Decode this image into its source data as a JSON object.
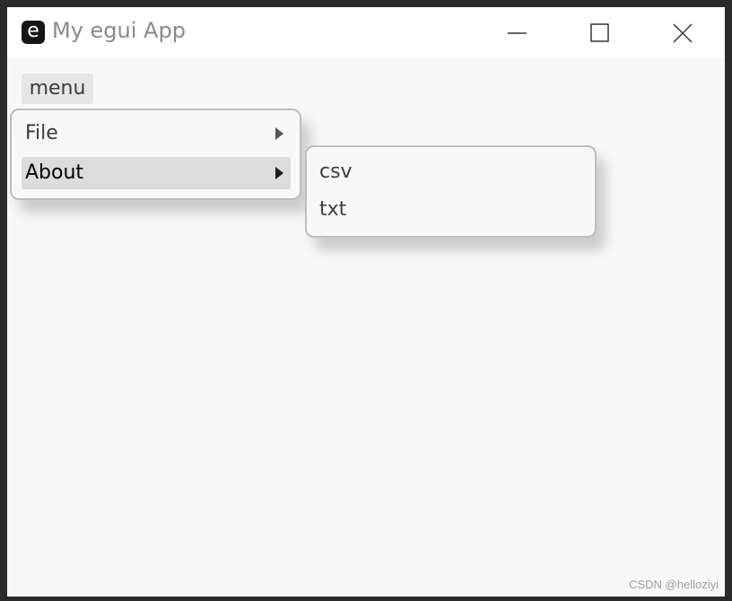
{
  "window": {
    "title": "My egui App",
    "icon": "egui-app-icon",
    "icon_letter": "e",
    "controls": [
      "minimize",
      "maximize",
      "close"
    ]
  },
  "menu_bar": {
    "menu_label": "menu"
  },
  "menu_popup": {
    "items": [
      {
        "label": "File",
        "has_submenu": true,
        "highlighted": false
      },
      {
        "label": "About",
        "has_submenu": true,
        "highlighted": true
      }
    ]
  },
  "submenu": {
    "items": [
      {
        "label": "csv"
      },
      {
        "label": "txt"
      }
    ]
  },
  "watermark": "CSDN @helloziyi",
  "colors": {
    "background": "#f8f8f8",
    "highlight": "#dcdcdc",
    "popup_border": "#bebebe",
    "title_text": "#8a8a8a"
  }
}
